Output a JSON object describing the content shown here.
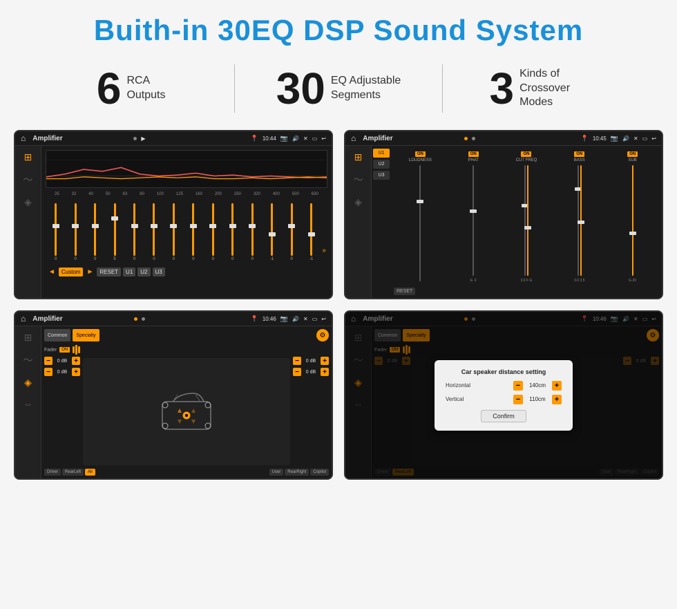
{
  "header": {
    "title": "Buith-in 30EQ DSP Sound System"
  },
  "stats": [
    {
      "number": "6",
      "text_line1": "RCA",
      "text_line2": "Outputs"
    },
    {
      "number": "30",
      "text_line1": "EQ Adjustable",
      "text_line2": "Segments"
    },
    {
      "number": "3",
      "text_line1": "Kinds of",
      "text_line2": "Crossover Modes"
    }
  ],
  "screens": {
    "eq": {
      "app_name": "Amplifier",
      "time": "10:44",
      "freq_labels": [
        "25",
        "32",
        "40",
        "50",
        "63",
        "80",
        "100",
        "125",
        "160",
        "200",
        "250",
        "320",
        "400",
        "500",
        "630"
      ],
      "slider_values": [
        "0",
        "0",
        "0",
        "5",
        "0",
        "0",
        "0",
        "0",
        "0",
        "0",
        "0",
        "-1",
        "0",
        "-1"
      ],
      "preset_label": "Custom",
      "buttons": [
        "RESET",
        "U1",
        "U2",
        "U3"
      ]
    },
    "crossover": {
      "app_name": "Amplifier",
      "time": "10:45",
      "presets": [
        "U1",
        "U2",
        "U3"
      ],
      "channels": [
        {
          "label": "LOUDNESS",
          "on": true
        },
        {
          "label": "PHAT",
          "on": true
        },
        {
          "label": "CUT FREQ",
          "on": true
        },
        {
          "label": "BASS",
          "on": true
        },
        {
          "label": "SUB",
          "on": true
        }
      ],
      "reset_label": "RESET"
    },
    "speaker": {
      "app_name": "Amplifier",
      "time": "10:46",
      "tabs": [
        "Common",
        "Specialty"
      ],
      "active_tab": "Specialty",
      "fader_label": "Fader",
      "on_label": "ON",
      "db_rows": [
        {
          "value": "0 dB"
        },
        {
          "value": "0 dB"
        },
        {
          "value": "0 dB"
        },
        {
          "value": "0 dB"
        }
      ],
      "bottom_buttons": [
        "Driver",
        "RearLeft",
        "All",
        "User",
        "RearRight",
        "Copilot"
      ],
      "active_button": "All"
    },
    "distance": {
      "app_name": "Amplifier",
      "time": "10:46",
      "tabs": [
        "Common",
        "Specialty"
      ],
      "dialog_title": "Car speaker distance setting",
      "horizontal_label": "Horizontal",
      "horizontal_value": "140cm",
      "vertical_label": "Vertical",
      "vertical_value": "110cm",
      "confirm_label": "Confirm",
      "db_rows": [
        {
          "value": "0 dB"
        },
        {
          "value": "0 dB"
        }
      ],
      "bottom_buttons": [
        "Driver",
        "RearLeft",
        "All",
        "User",
        "RearRight",
        "Copilot"
      ]
    }
  }
}
